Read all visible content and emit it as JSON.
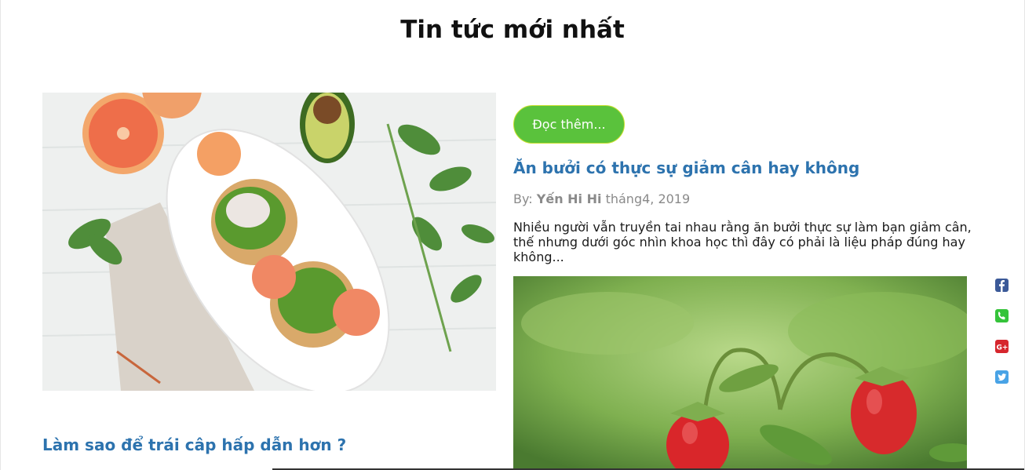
{
  "page_title": "Tin tức mới nhất",
  "post": {
    "read_more_label": "Đọc thêm...",
    "title": "Ăn bưởi có thực sự giảm cân hay không",
    "byline_prefix": "By:",
    "author": "Yến Hi Hi",
    "date": "tháng4, 2019",
    "excerpt": "Nhiều người vẫn truyền tai nhau rằng ăn bưởi thực sự làm bạn giảm cân, thế nhưng dưới góc nhìn khoa học thì đây có phải là liệu pháp đúng hay không..."
  },
  "second_post": {
    "title": "Làm sao để trái câp hấp dẫn hơn ?"
  },
  "share": [
    {
      "name": "facebook-icon",
      "color": "#3b5998"
    },
    {
      "name": "phone-icon",
      "color": "#35c33a"
    },
    {
      "name": "google-plus-icon",
      "color": "#d6262d"
    },
    {
      "name": "twitter-icon",
      "color": "#48a3e6"
    }
  ],
  "colors": {
    "accent_green": "#5ac23c",
    "link_blue": "#2d73ae",
    "meta_gray": "#8a8a8a"
  }
}
